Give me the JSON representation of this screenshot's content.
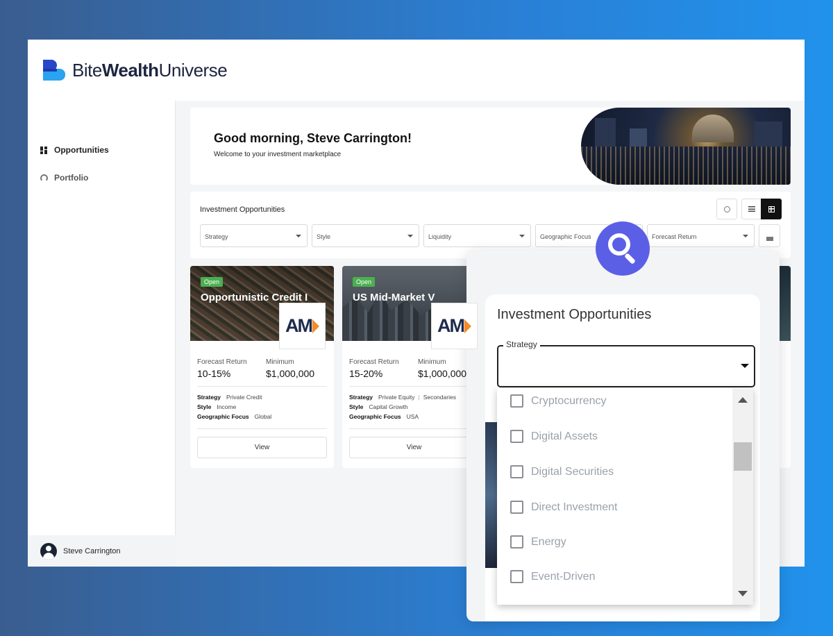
{
  "brand": {
    "part1": "Bite",
    "part2": "Wealth",
    "part3": "Universe"
  },
  "sidebar": {
    "items": [
      {
        "label": "Opportunities",
        "icon": "grid-icon"
      },
      {
        "label": "Portfolio",
        "icon": "gauge-icon"
      }
    ],
    "user": {
      "name": "Steve Carrington"
    }
  },
  "welcome": {
    "greeting": "Good morning, Steve Carrington!",
    "subtitle": "Welcome to your investment marketplace"
  },
  "filters": {
    "title": "Investment Opportunities",
    "selects": [
      "Strategy",
      "Style",
      "Liquidity",
      "Geographic Focus",
      "Forecast Return"
    ],
    "view_mode": "grid"
  },
  "cards": [
    {
      "status": "Open",
      "title": "Opportunistic Credit I",
      "logo": "AM",
      "forecast_label": "Forecast Return",
      "forecast_value": "10-15%",
      "minimum_label": "Minimum",
      "minimum_value": "$1,000,000",
      "strategy_label": "Strategy",
      "strategy_value": "Private Credit",
      "style_label": "Style",
      "style_value": "Income",
      "geo_label": "Geographic Focus",
      "geo_value": "Global",
      "view_label": "View"
    },
    {
      "status": "Open",
      "title": "US Mid-Market V",
      "logo": "AM",
      "forecast_label": "Forecast Return",
      "forecast_value": "15-20%",
      "minimum_label": "Minimum",
      "minimum_value": "$1,000,000",
      "strategy_label": "Strategy",
      "strategy_value": "Private Equity",
      "strategy_value2": "Secondaries",
      "style_label": "Style",
      "style_value": "Capital Growth",
      "geo_label": "Geographic Focus",
      "geo_value": "USA",
      "view_label": "View"
    }
  ],
  "zoom": {
    "title": "Investment Opportunities",
    "strategy_label": "Strategy",
    "options": [
      "Cryptocurrency",
      "Digital Assets",
      "Digital Securities",
      "Direct Investment",
      "Energy",
      "Event-Driven"
    ]
  },
  "colors": {
    "accent": "#5b5fe6",
    "badge": "#4caf50",
    "brand_dark": "#2647c8",
    "brand_light": "#2aa3f0"
  }
}
